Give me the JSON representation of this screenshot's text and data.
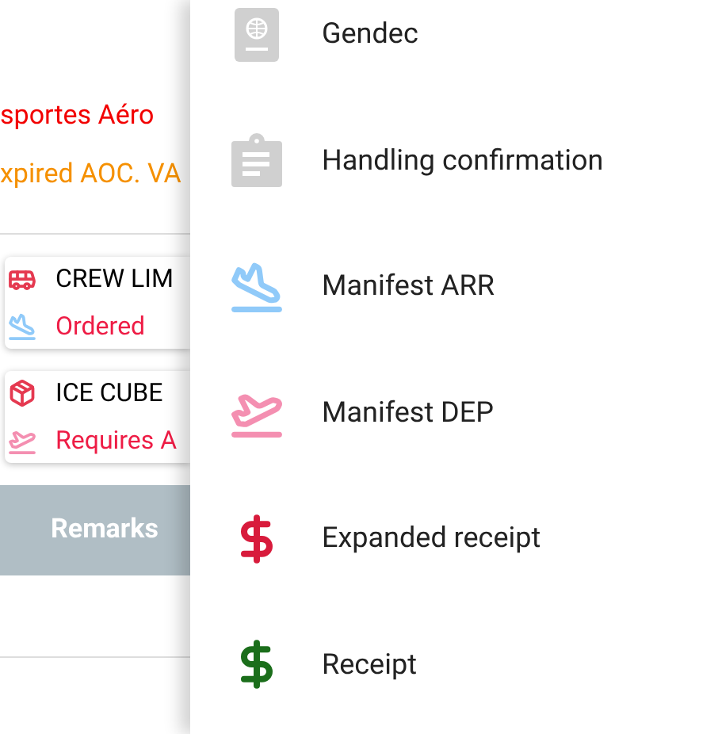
{
  "background": {
    "operator": "sportes Aéro",
    "warning": "xpired AOC. VA",
    "services": [
      {
        "name": "CREW LIM",
        "kind": "bus",
        "status": "Ordered",
        "status_icon": {
          "kind": "arrival"
        }
      },
      {
        "name": "ICE CUBE",
        "kind": "package",
        "status": "Requires A",
        "status_icon": {
          "kind": "departure"
        }
      }
    ],
    "remarks_button": "Remarks"
  },
  "drawer": {
    "items": [
      {
        "label": "Gendec",
        "kind": "passport",
        "color": "#d0d0d0"
      },
      {
        "label": "Handling confirmation",
        "kind": "clipboard",
        "color": "#d0d0d0"
      },
      {
        "label": "Manifest ARR",
        "kind": "arrival",
        "color": "#90caf9"
      },
      {
        "label": "Manifest DEP",
        "kind": "departure",
        "color": "#f48fb1"
      },
      {
        "label": "Expanded receipt",
        "kind": "dollar",
        "color": "#d81b3c"
      },
      {
        "label": "Receipt",
        "kind": "dollar",
        "color": "#1b6e1b"
      }
    ]
  }
}
